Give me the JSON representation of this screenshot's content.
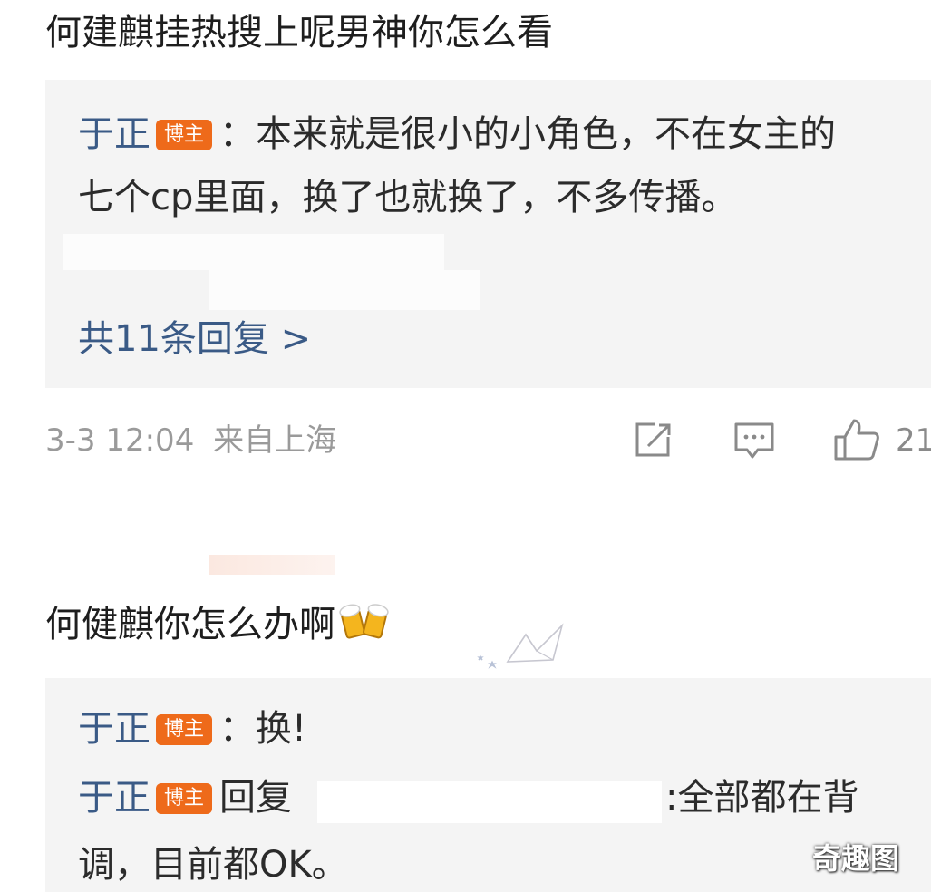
{
  "comment1": {
    "text": "何建麒挂热搜上呢男神你怎么看",
    "reply": {
      "username": "于正",
      "badge": "博主",
      "line1": "：本来就是很小的小角色，不在女主的",
      "line2": "七个cp里面，换了也就换了，不多传播。"
    },
    "more_replies": "共11条回复 >",
    "meta": {
      "time": "3-3 12:04",
      "location": "来自上海",
      "like_count": "21"
    }
  },
  "comment2": {
    "text": "何健麒你怎么办啊",
    "emoji": "beer-cheers-icon",
    "replies": [
      {
        "username": "于正",
        "badge": "博主",
        "text": "：换!"
      },
      {
        "username": "于正",
        "badge": "博主",
        "prefix": "回复",
        "text": ":全部都在背",
        "line2": "调，目前都OK。"
      }
    ]
  },
  "watermark": "奇趣图",
  "colors": {
    "username": "#3a5a86",
    "badge": "#ee6a1a",
    "meta": "#9a9a9a",
    "reply_bg": "#f4f4f4"
  }
}
